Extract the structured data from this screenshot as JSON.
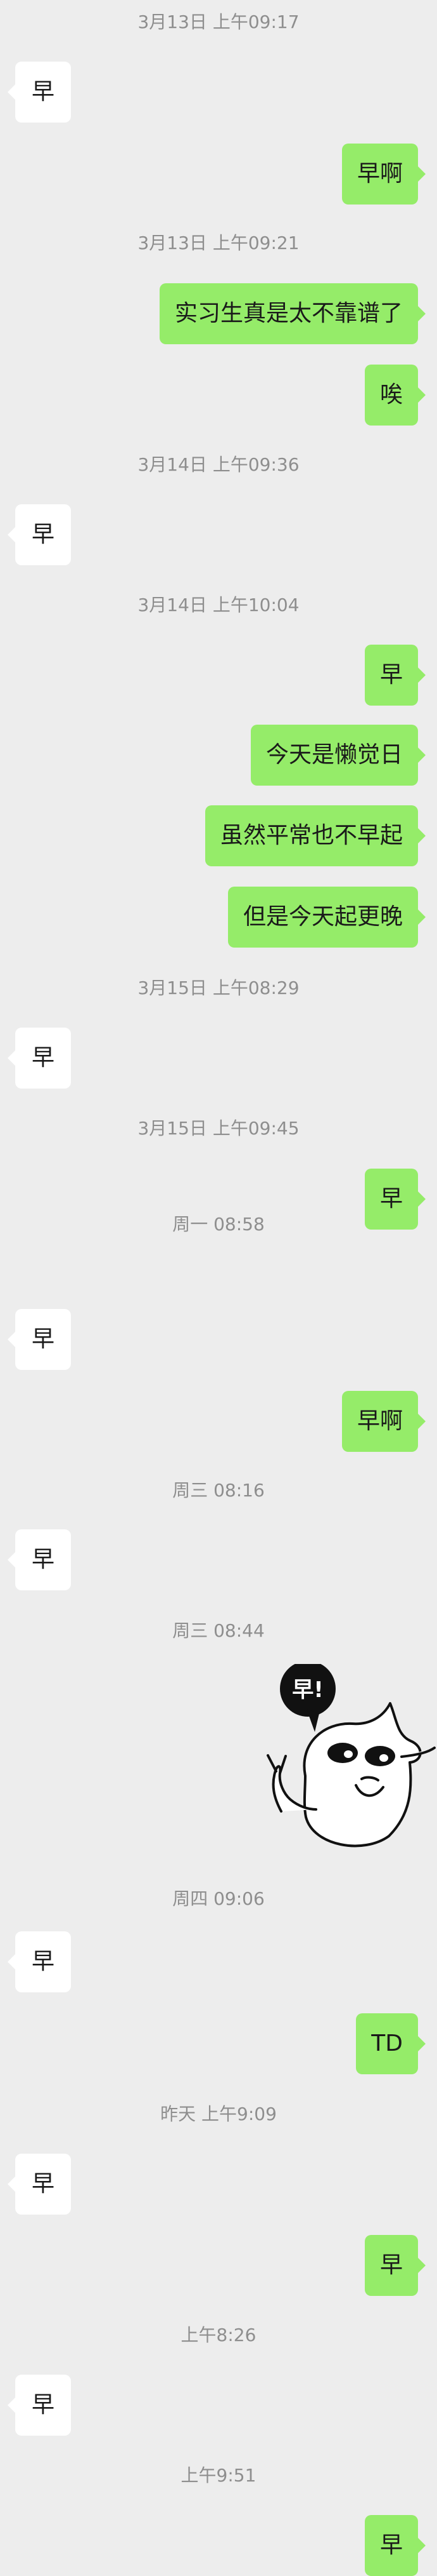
{
  "messages": [
    {
      "kind": "time",
      "text": "3月13日 上午09:17"
    },
    {
      "kind": "left",
      "text": "早"
    },
    {
      "kind": "right",
      "text": "早啊"
    },
    {
      "kind": "time",
      "text": "3月13日 上午09:21"
    },
    {
      "kind": "right",
      "text": "实习生真是太不靠谱了"
    },
    {
      "kind": "right",
      "text": "唉"
    },
    {
      "kind": "time",
      "text": "3月14日 上午09:36"
    },
    {
      "kind": "left",
      "text": "早"
    },
    {
      "kind": "time",
      "text": "3月14日 上午10:04"
    },
    {
      "kind": "right",
      "text": "早"
    },
    {
      "kind": "right",
      "text": "今天是懒觉日"
    },
    {
      "kind": "right",
      "text": "虽然平常也不早起"
    },
    {
      "kind": "right",
      "text": "但是今天起更晚"
    },
    {
      "kind": "time",
      "text": "3月15日 上午08:29"
    },
    {
      "kind": "left",
      "text": "早"
    },
    {
      "kind": "time",
      "text": "3月15日 上午09:45"
    },
    {
      "kind": "right",
      "text": "早"
    },
    {
      "kind": "time",
      "text": "周一 08:58"
    },
    {
      "kind": "left",
      "text": "早"
    },
    {
      "kind": "right",
      "text": "早啊"
    },
    {
      "kind": "time",
      "text": "周三 08:16"
    },
    {
      "kind": "left",
      "text": "早"
    },
    {
      "kind": "time",
      "text": "周三 08:44"
    },
    {
      "kind": "time",
      "text": "周四 09:06"
    },
    {
      "kind": "left",
      "text": "早"
    },
    {
      "kind": "right",
      "text": "TD"
    },
    {
      "kind": "time",
      "text": "昨天 上午9:09"
    },
    {
      "kind": "left",
      "text": "早"
    },
    {
      "kind": "right",
      "text": "早"
    },
    {
      "kind": "time",
      "text": "上午8:26"
    },
    {
      "kind": "left",
      "text": "早"
    },
    {
      "kind": "time",
      "text": "上午9:51"
    },
    {
      "kind": "right",
      "text": "早"
    }
  ],
  "sticker": {
    "text": "早!",
    "icon": "waving-cartoon-sticker"
  }
}
